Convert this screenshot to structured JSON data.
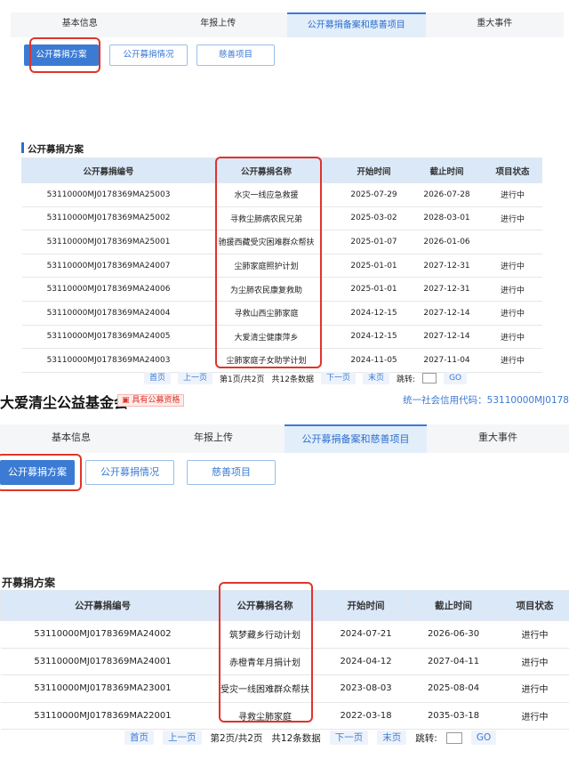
{
  "panel1": {
    "tabs": [
      "基本信息",
      "年报上传",
      "公开募捐备案和慈善项目",
      "重大事件"
    ],
    "active_tab": 2,
    "subbuttons": [
      "公开募捐方案",
      "公开募捐情况",
      "慈善项目"
    ],
    "section_title": "公开募捐方案",
    "headers": [
      "公开募捐编号",
      "公开募捐名称",
      "开始时间",
      "截止时间",
      "项目状态"
    ],
    "rows": [
      [
        "53110000MJ0178369MA25003",
        "水灾一线应急救援",
        "2025-07-29",
        "2026-07-28",
        "进行中"
      ],
      [
        "53110000MJ0178369MA25002",
        "寻救尘肺病农民兄弟",
        "2025-03-02",
        "2028-03-01",
        "进行中"
      ],
      [
        "53110000MJ0178369MA25001",
        "驰援西藏受灾困难群众帮扶",
        "2025-01-07",
        "2026-01-06",
        ""
      ],
      [
        "53110000MJ0178369MA24007",
        "尘肺家庭照护计划",
        "2025-01-01",
        "2027-12-31",
        "进行中"
      ],
      [
        "53110000MJ0178369MA24006",
        "为尘肺农民康复救助",
        "2025-01-01",
        "2027-12-31",
        "进行中"
      ],
      [
        "53110000MJ0178369MA24004",
        "寻救山西尘肺家庭",
        "2024-12-15",
        "2027-12-14",
        "进行中"
      ],
      [
        "53110000MJ0178369MA24005",
        "大爱清尘健康萍乡",
        "2024-12-15",
        "2027-12-14",
        "进行中"
      ],
      [
        "53110000MJ0178369MA24003",
        "尘肺家庭子女助学计划",
        "2024-11-05",
        "2027-11-04",
        "进行中"
      ]
    ],
    "pager": {
      "first": "首页",
      "prev": "上一页",
      "info": "第1页/共2页",
      "total": "共12条数据",
      "next": "下一页",
      "last": "末页",
      "jump": "跳转:",
      "go": "GO"
    }
  },
  "panel2": {
    "org_name": "大爱清尘公益基金会",
    "badge": "具有公募资格",
    "credit_code": "统一社会信用代码：53110000MJ0178",
    "tabs": [
      "基本信息",
      "年报上传",
      "公开募捐备案和慈善项目",
      "重大事件"
    ],
    "active_tab": 2,
    "subbuttons": [
      "公开募捐方案",
      "公开募捐情况",
      "慈善项目"
    ],
    "section_title": "开募捐方案",
    "headers": [
      "公开募捐编号",
      "公开募捐名称",
      "开始时间",
      "截止时间",
      "项目状态"
    ],
    "rows": [
      [
        "53110000MJ0178369MA24002",
        "筑梦藏乡行动计划",
        "2024-07-21",
        "2026-06-30",
        "进行中"
      ],
      [
        "53110000MJ0178369MA24001",
        "赤橙青年月捐计划",
        "2024-04-12",
        "2027-04-11",
        "进行中"
      ],
      [
        "53110000MJ0178369MA23001",
        "受灾一线困难群众帮扶",
        "2023-08-03",
        "2025-08-04",
        "进行中"
      ],
      [
        "53110000MJ0178369MA22001",
        "寻救尘肺家庭",
        "2022-03-18",
        "2035-03-18",
        "进行中"
      ]
    ],
    "pager": {
      "first": "首页",
      "prev": "上一页",
      "info": "第2页/共2页",
      "total": "共12条数据",
      "next": "下一页",
      "last": "末页",
      "jump": "跳转:",
      "go": "GO"
    }
  },
  "colors": {
    "accent": "#3b7bd4",
    "highlight_box": "#e0342a",
    "header_bg": "#dbe8f7"
  }
}
